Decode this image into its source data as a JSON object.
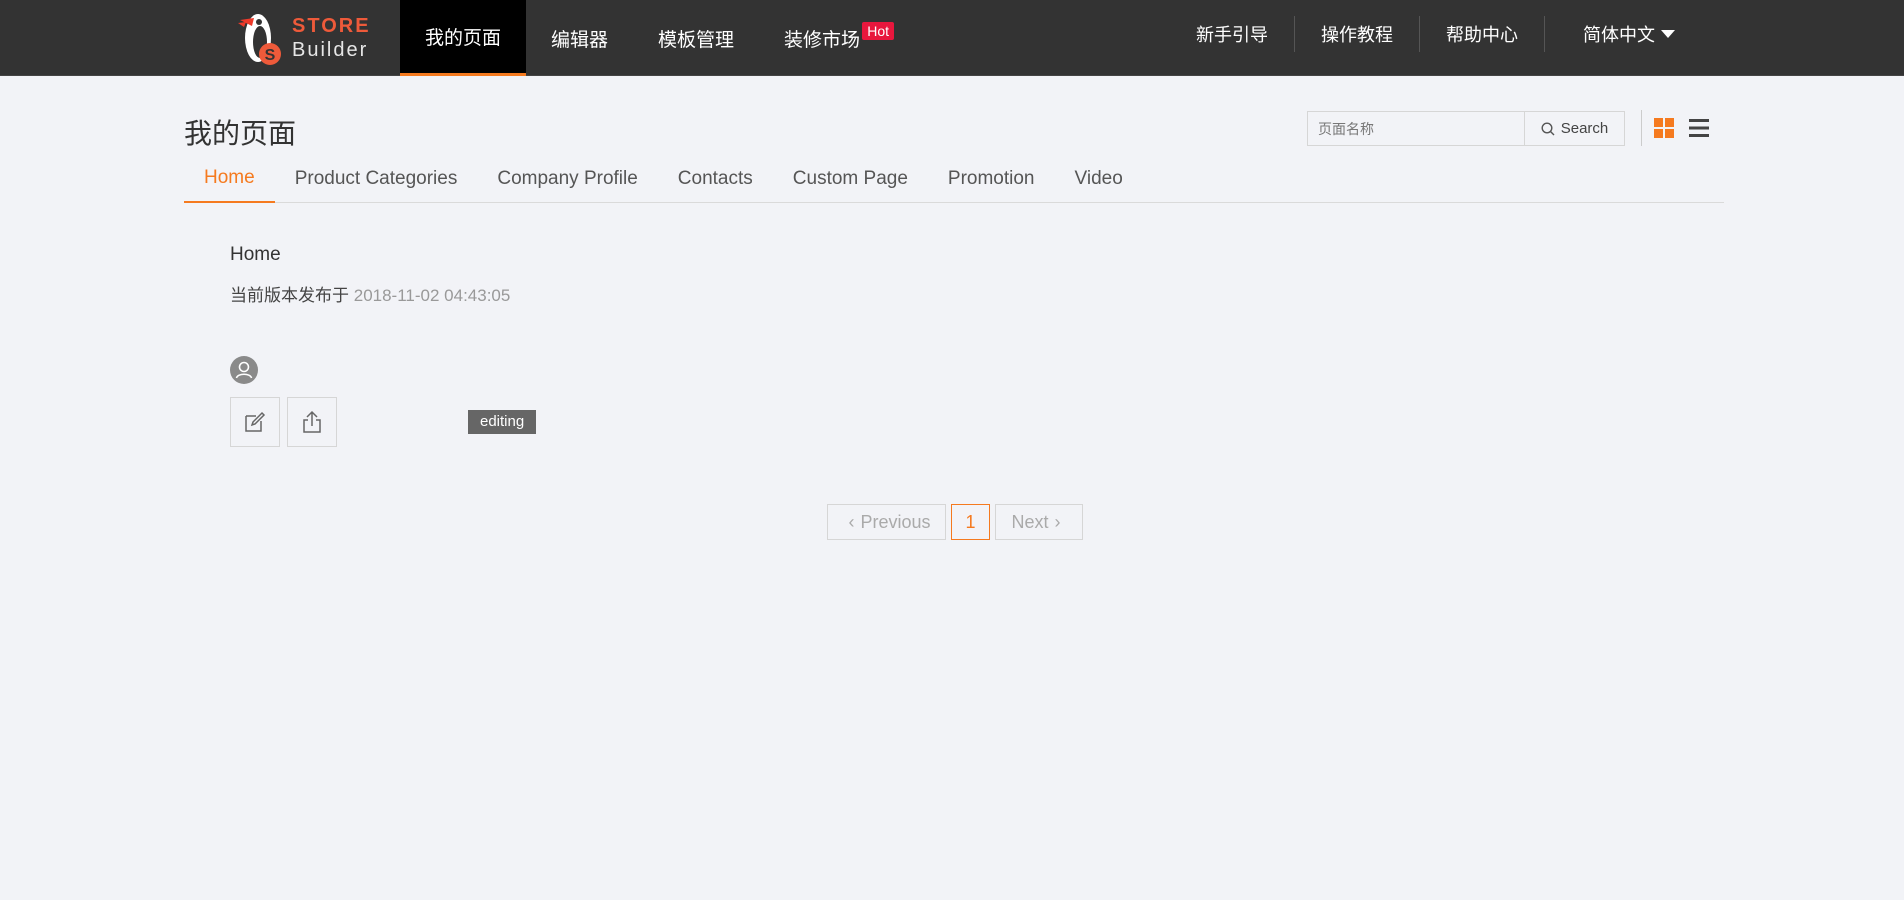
{
  "brand": {
    "line1": "STORE",
    "line2": "Builder",
    "accent": "#ee5a3a"
  },
  "nav": {
    "items": [
      {
        "label": "我的页面",
        "active": true
      },
      {
        "label": "编辑器",
        "active": false
      },
      {
        "label": "模板管理",
        "active": false
      },
      {
        "label": "装修市场",
        "active": false,
        "badge": "Hot"
      }
    ],
    "right": [
      {
        "label": "新手引导"
      },
      {
        "label": "操作教程"
      },
      {
        "label": "帮助中心"
      },
      {
        "label": "简体中文"
      }
    ]
  },
  "page": {
    "title": "我的页面",
    "search": {
      "placeholder": "页面名称",
      "button": "Search"
    }
  },
  "tabs": [
    {
      "label": "Home",
      "active": true
    },
    {
      "label": "Product Categories"
    },
    {
      "label": "Company Profile"
    },
    {
      "label": "Contacts"
    },
    {
      "label": "Custom Page"
    },
    {
      "label": "Promotion"
    },
    {
      "label": "Video"
    }
  ],
  "card": {
    "title": "Home",
    "published_prefix": "当前版本发布于",
    "published_date": "2018-11-02 04:43:05",
    "status": "editing"
  },
  "pagination": {
    "prev": "Previous",
    "current": "1",
    "next": "Next"
  },
  "colors": {
    "accent": "#f57a1f",
    "topbar": "#333333",
    "hot": "#e8173d",
    "background": "#f2f3f7"
  }
}
